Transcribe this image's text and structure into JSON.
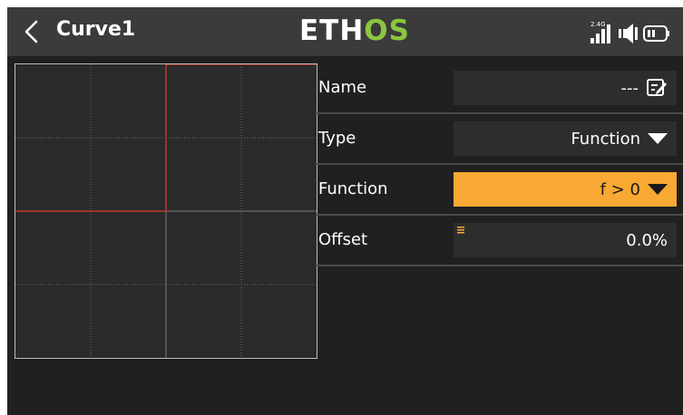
{
  "header": {
    "title": "Curve1",
    "logo_left": "ETH",
    "logo_right": "OS",
    "rf_band": "2.4G"
  },
  "colors": {
    "accent": "#f7a933",
    "logo_green": "#8cc63f",
    "curve_red": "#c0392b"
  },
  "curve_graph": {
    "function": "f > 0",
    "x_range": [
      -100,
      100
    ],
    "y_range": [
      -100,
      100
    ],
    "grid": true
  },
  "settings": {
    "name": {
      "label": "Name",
      "value": "---",
      "icon": "edit-icon"
    },
    "type": {
      "label": "Type",
      "value": "Function",
      "icon": "dropdown-triangle-icon"
    },
    "function": {
      "label": "Function",
      "value": "f > 0",
      "icon": "dropdown-triangle-icon"
    },
    "offset": {
      "label": "Offset",
      "value": "0.0%",
      "icon": "adjust-marker-icon"
    }
  }
}
